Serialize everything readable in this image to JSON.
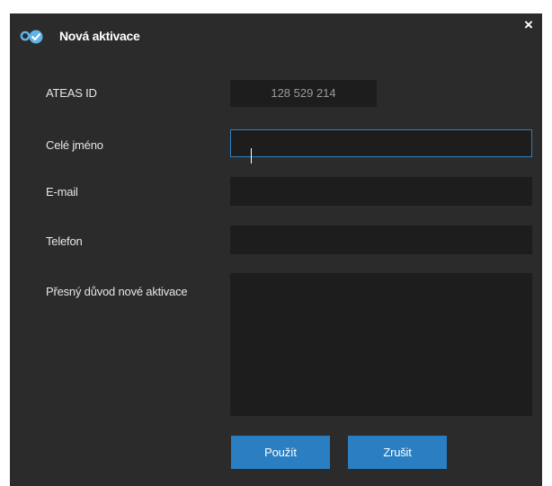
{
  "dialog": {
    "title": "Nová aktivace",
    "close_label": "×"
  },
  "form": {
    "ateas_id_label": "ATEAS ID",
    "ateas_id_value": "128 529 214",
    "full_name_label": "Celé jméno",
    "full_name_value": "",
    "email_label": "E-mail",
    "email_value": "",
    "phone_label": "Telefon",
    "phone_value": "",
    "reason_label": "Přesný důvod nové aktivace",
    "reason_value": ""
  },
  "buttons": {
    "apply_label": "Použít",
    "cancel_label": "Zrušit"
  },
  "colors": {
    "dialog_bg": "#2b2b2b",
    "field_bg": "#1d1d1d",
    "accent": "#2a7fc2",
    "focus_border": "#2e7fc0"
  },
  "icons": {
    "app": "key-check-icon",
    "close": "close-icon"
  }
}
